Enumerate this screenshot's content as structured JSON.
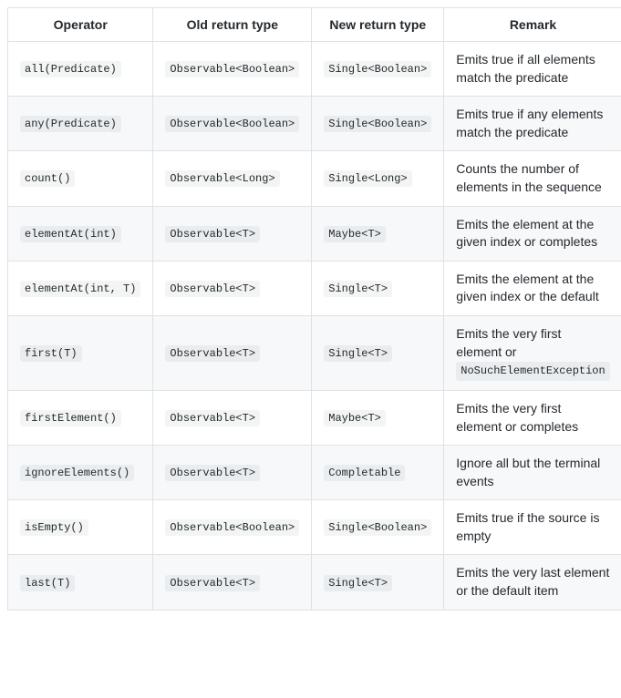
{
  "headers": {
    "operator": "Operator",
    "old_return": "Old return type",
    "new_return": "New return type",
    "remark": "Remark"
  },
  "rows": [
    {
      "operator": "all(Predicate)",
      "old": "Observable<Boolean>",
      "new": "Single<Boolean>",
      "remark_text": "Emits true if all elements match the predicate",
      "remark_code": ""
    },
    {
      "operator": "any(Predicate)",
      "old": "Observable<Boolean>",
      "new": "Single<Boolean>",
      "remark_text": "Emits true if any elements match the predicate",
      "remark_code": ""
    },
    {
      "operator": "count()",
      "old": "Observable<Long>",
      "new": "Single<Long>",
      "remark_text": "Counts the number of elements in the sequence",
      "remark_code": ""
    },
    {
      "operator": "elementAt(int)",
      "old": "Observable<T>",
      "new": "Maybe<T>",
      "remark_text": "Emits the element at the given index or completes",
      "remark_code": ""
    },
    {
      "operator": "elementAt(int, T)",
      "old": "Observable<T>",
      "new": "Single<T>",
      "remark_text": "Emits the element at the given index or the default",
      "remark_code": ""
    },
    {
      "operator": "first(T)",
      "old": "Observable<T>",
      "new": "Single<T>",
      "remark_text": "Emits the very first element or ",
      "remark_code": "NoSuchElementException"
    },
    {
      "operator": "firstElement()",
      "old": "Observable<T>",
      "new": "Maybe<T>",
      "remark_text": "Emits the very first element or completes",
      "remark_code": ""
    },
    {
      "operator": "ignoreElements()",
      "old": "Observable<T>",
      "new": "Completable",
      "remark_text": "Ignore all but the terminal events",
      "remark_code": ""
    },
    {
      "operator": "isEmpty()",
      "old": "Observable<Boolean>",
      "new": "Single<Boolean>",
      "remark_text": "Emits true if the source is empty",
      "remark_code": ""
    },
    {
      "operator": "last(T)",
      "old": "Observable<T>",
      "new": "Single<T>",
      "remark_text": "Emits the very last element or the default item",
      "remark_code": ""
    }
  ]
}
